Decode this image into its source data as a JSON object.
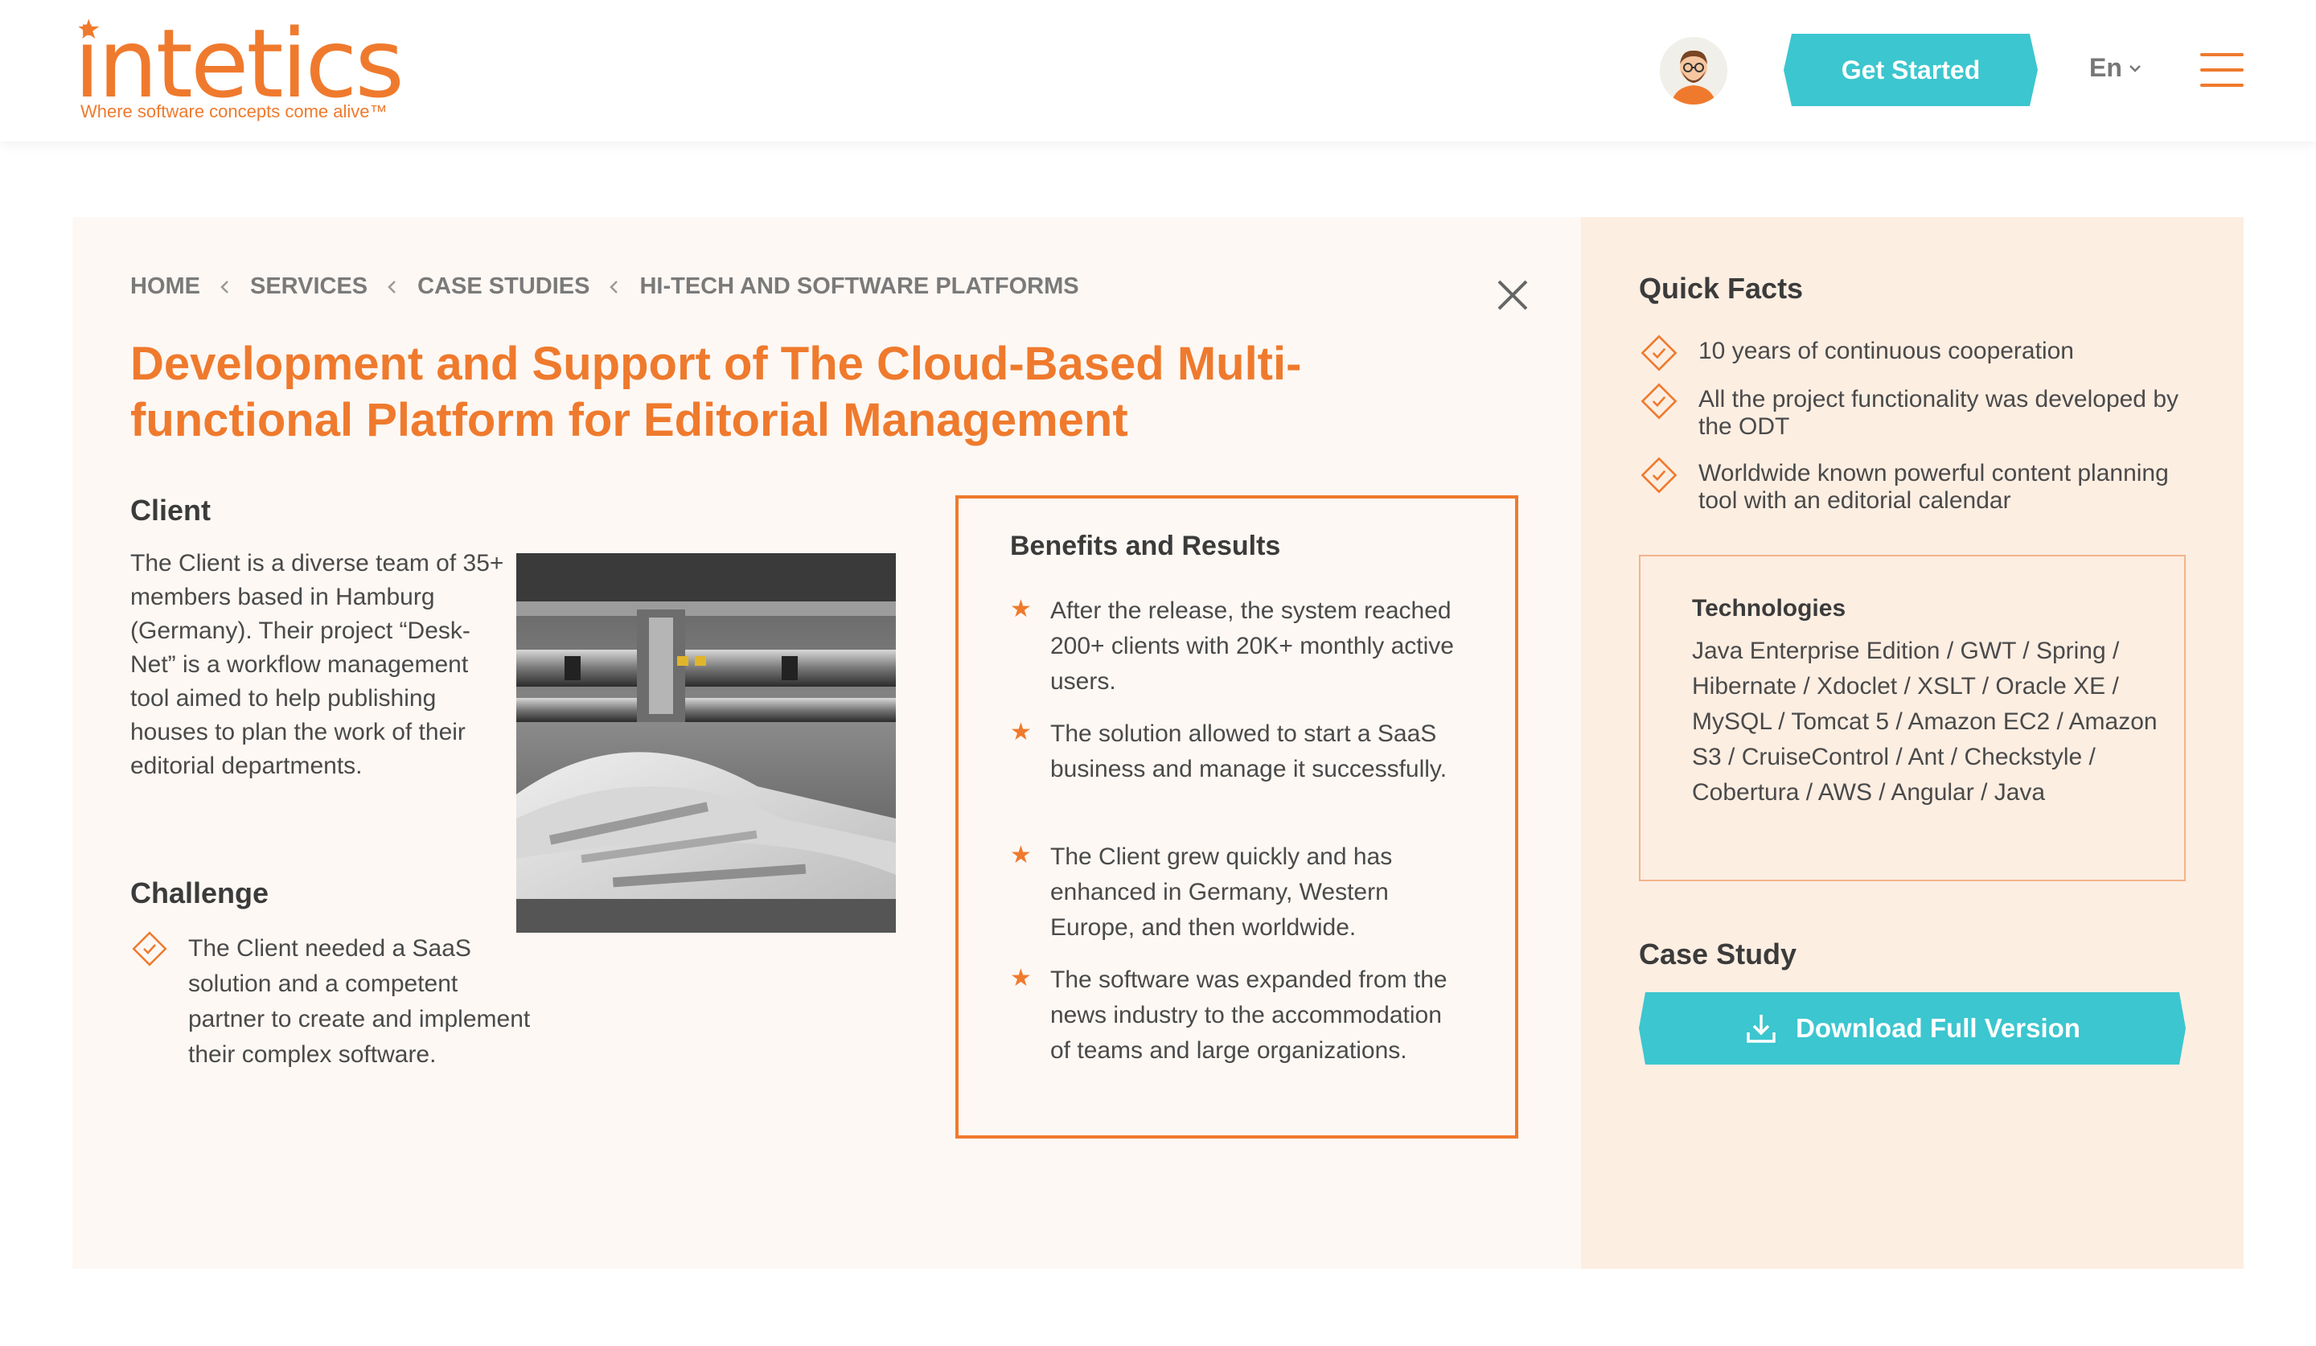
{
  "header": {
    "logo_word": "intetics",
    "logo_tagline": "Where software concepts come alive™",
    "cta_label": "Get Started",
    "language": "En",
    "icons": {
      "avatar": "consultant-avatar",
      "menu": "hamburger-menu-icon",
      "dropdown": "chevron-down-icon"
    }
  },
  "breadcrumb": [
    "HOME",
    "SERVICES",
    "CASE STUDIES",
    "HI-TECH AND SOFTWARE PLATFORMS"
  ],
  "title": "Development and Support of The Cloud-Based Multi-functional Platform for Editorial Management",
  "client": {
    "heading": "Client",
    "text": "The Client is a diverse team of 35+ members based in Hamburg (Germany). Their project “Desk-Net” is a workflow management tool aimed to help publishing houses to plan the work of their editorial departments."
  },
  "challenge": {
    "heading": "Challenge",
    "text": "The Client needed a SaaS solution and a competent partner to create and implement their complex software."
  },
  "benefits": {
    "heading": "Benefits and Results",
    "items": [
      "After the release, the system reached 200+ clients with 20K+ monthly active users.",
      "The solution allowed to start a SaaS business and manage it successfully.",
      "The Client grew quickly and has enhanced in Germany, Western Europe, and then worldwide.",
      "The software was expanded from the news industry to the accommodation of teams and large organizations."
    ]
  },
  "quick_facts": {
    "heading": "Quick Facts",
    "items": [
      "10 years of continuous cooperation",
      "All the project functionality was developed by the ODT",
      "Worldwide known powerful content planning tool with an editorial calendar"
    ]
  },
  "technologies": {
    "heading": "Technologies",
    "text": "Java Enterprise Edition / GWT / Spring / Hibernate / Xdoclet / XSLT / Oracle XE / MySQL / Tomcat 5 / Amazon EC2 / Amazon S3 / CruiseControl / Ant / Checkstyle / Cobertura / AWS / Angular / Java"
  },
  "case_study": {
    "heading": "Case Study",
    "download_label": "Download Full Version"
  },
  "colors": {
    "brand_orange": "#ef7a2d",
    "accent_teal": "#3cc6cf"
  }
}
